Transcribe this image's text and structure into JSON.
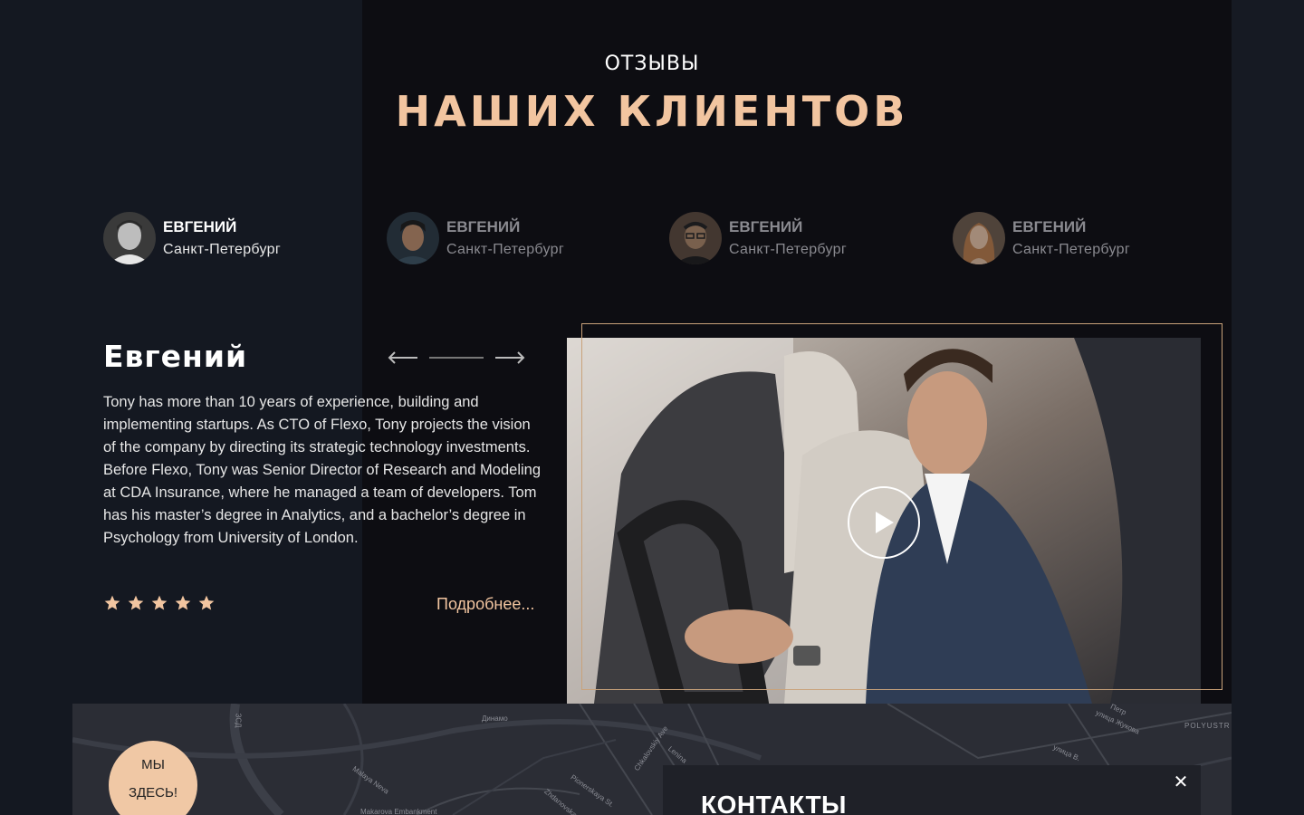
{
  "header": {
    "eyebrow": "ОТЗЫВЫ",
    "headline": "НАШИХ КЛИЕНТОВ"
  },
  "reviewers": [
    {
      "name": "ЕВГЕНИЙ",
      "city": "Санкт-Петербург",
      "active": true
    },
    {
      "name": "ЕВГЕНИЙ",
      "city": "Санкт-Петербург",
      "active": false
    },
    {
      "name": "ЕВГЕНИЙ",
      "city": "Санкт-Петербург",
      "active": false
    },
    {
      "name": "ЕВГЕНИЙ",
      "city": "Санкт-Петербург",
      "active": false
    }
  ],
  "detail": {
    "name": "Евгений",
    "text": "Tony has more than 10 years of experience, building and implementing startups. As CTO of Flexo, Tony projects the vision of the company by directing its strategic technology investments. Before Flexo, Tony was Senior Director of Research and Modeling at CDA Insurance, where he managed a team of developers. Tom has his master’s degree in Analytics, and a bachelor’s degree in Psychology from University of London.",
    "rating": 5,
    "more_label": "Подробнее..."
  },
  "nav": {
    "prev_icon": "arrow-left-icon",
    "next_icon": "arrow-right-icon"
  },
  "video": {
    "play_icon": "play-icon"
  },
  "map": {
    "badge_line1": "МЫ",
    "badge_line2": "ЗДЕСЬ!",
    "labels": [
      "ЗСД",
      "Динамо",
      "Malaya Neva",
      "Makarova Embankment",
      "Pionerskaya St.",
      "Zhdanovskaya",
      "Chkalovskiy Ave",
      "Lenina",
      "улица Жукова",
      "улица В.",
      "Петр",
      "POLYUSTR"
    ]
  },
  "contacts": {
    "title": "КОНТАКТЫ",
    "close_icon": "close-icon"
  },
  "colors": {
    "accent": "#f2c5a0",
    "frame": "#c9a27a",
    "bg_dark": "#0d0d12",
    "bg_side": "#141821"
  }
}
